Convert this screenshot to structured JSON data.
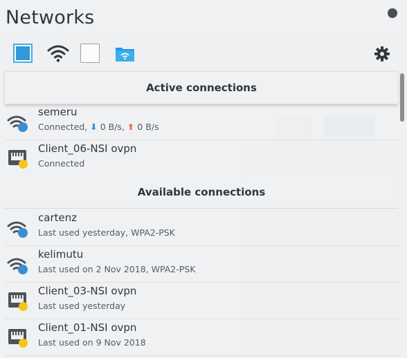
{
  "header": {
    "title": "Networks"
  },
  "toolbar": {
    "buttons": [
      {
        "icon": "wired-toggle-icon",
        "state": "on"
      },
      {
        "icon": "wifi-icon"
      },
      {
        "icon": "mobile-broadband-toggle-icon",
        "state": "off"
      },
      {
        "icon": "hotspot-folder-icon"
      }
    ],
    "settings_icon": "gear-icon"
  },
  "sections": {
    "active_label": "Active connections",
    "available_label": "Available connections"
  },
  "active": [
    {
      "name": "semeru",
      "status_prefix": "Connected, ",
      "down_arrow": "⬇",
      "down": " 0 B/s, ",
      "up_arrow": "⬆",
      "up": " 0 B/s",
      "icon": "wifi-signal-icon"
    },
    {
      "name": "Client_06-NSI ovpn",
      "status": "Connected",
      "icon": "vpn-wired-icon"
    }
  ],
  "available": [
    {
      "name": "cartenz",
      "status": "Last used yesterday, WPA2-PSK",
      "icon": "wifi-signal-icon"
    },
    {
      "name": "kelimutu",
      "status": "Last used on 2 Nov 2018, WPA2-PSK",
      "icon": "wifi-signal-icon"
    },
    {
      "name": "Client_03-NSI ovpn",
      "status": "Last used yesterday",
      "icon": "vpn-wired-icon"
    },
    {
      "name": "Client_01-NSI ovpn",
      "status": "Last used on 9 Nov 2018",
      "icon": "vpn-wired-icon"
    }
  ],
  "colors": {
    "accent": "#3daee9",
    "badge_blue": "#3a8ed3",
    "badge_yellow": "#f5c518",
    "upload": "#e8734a"
  }
}
